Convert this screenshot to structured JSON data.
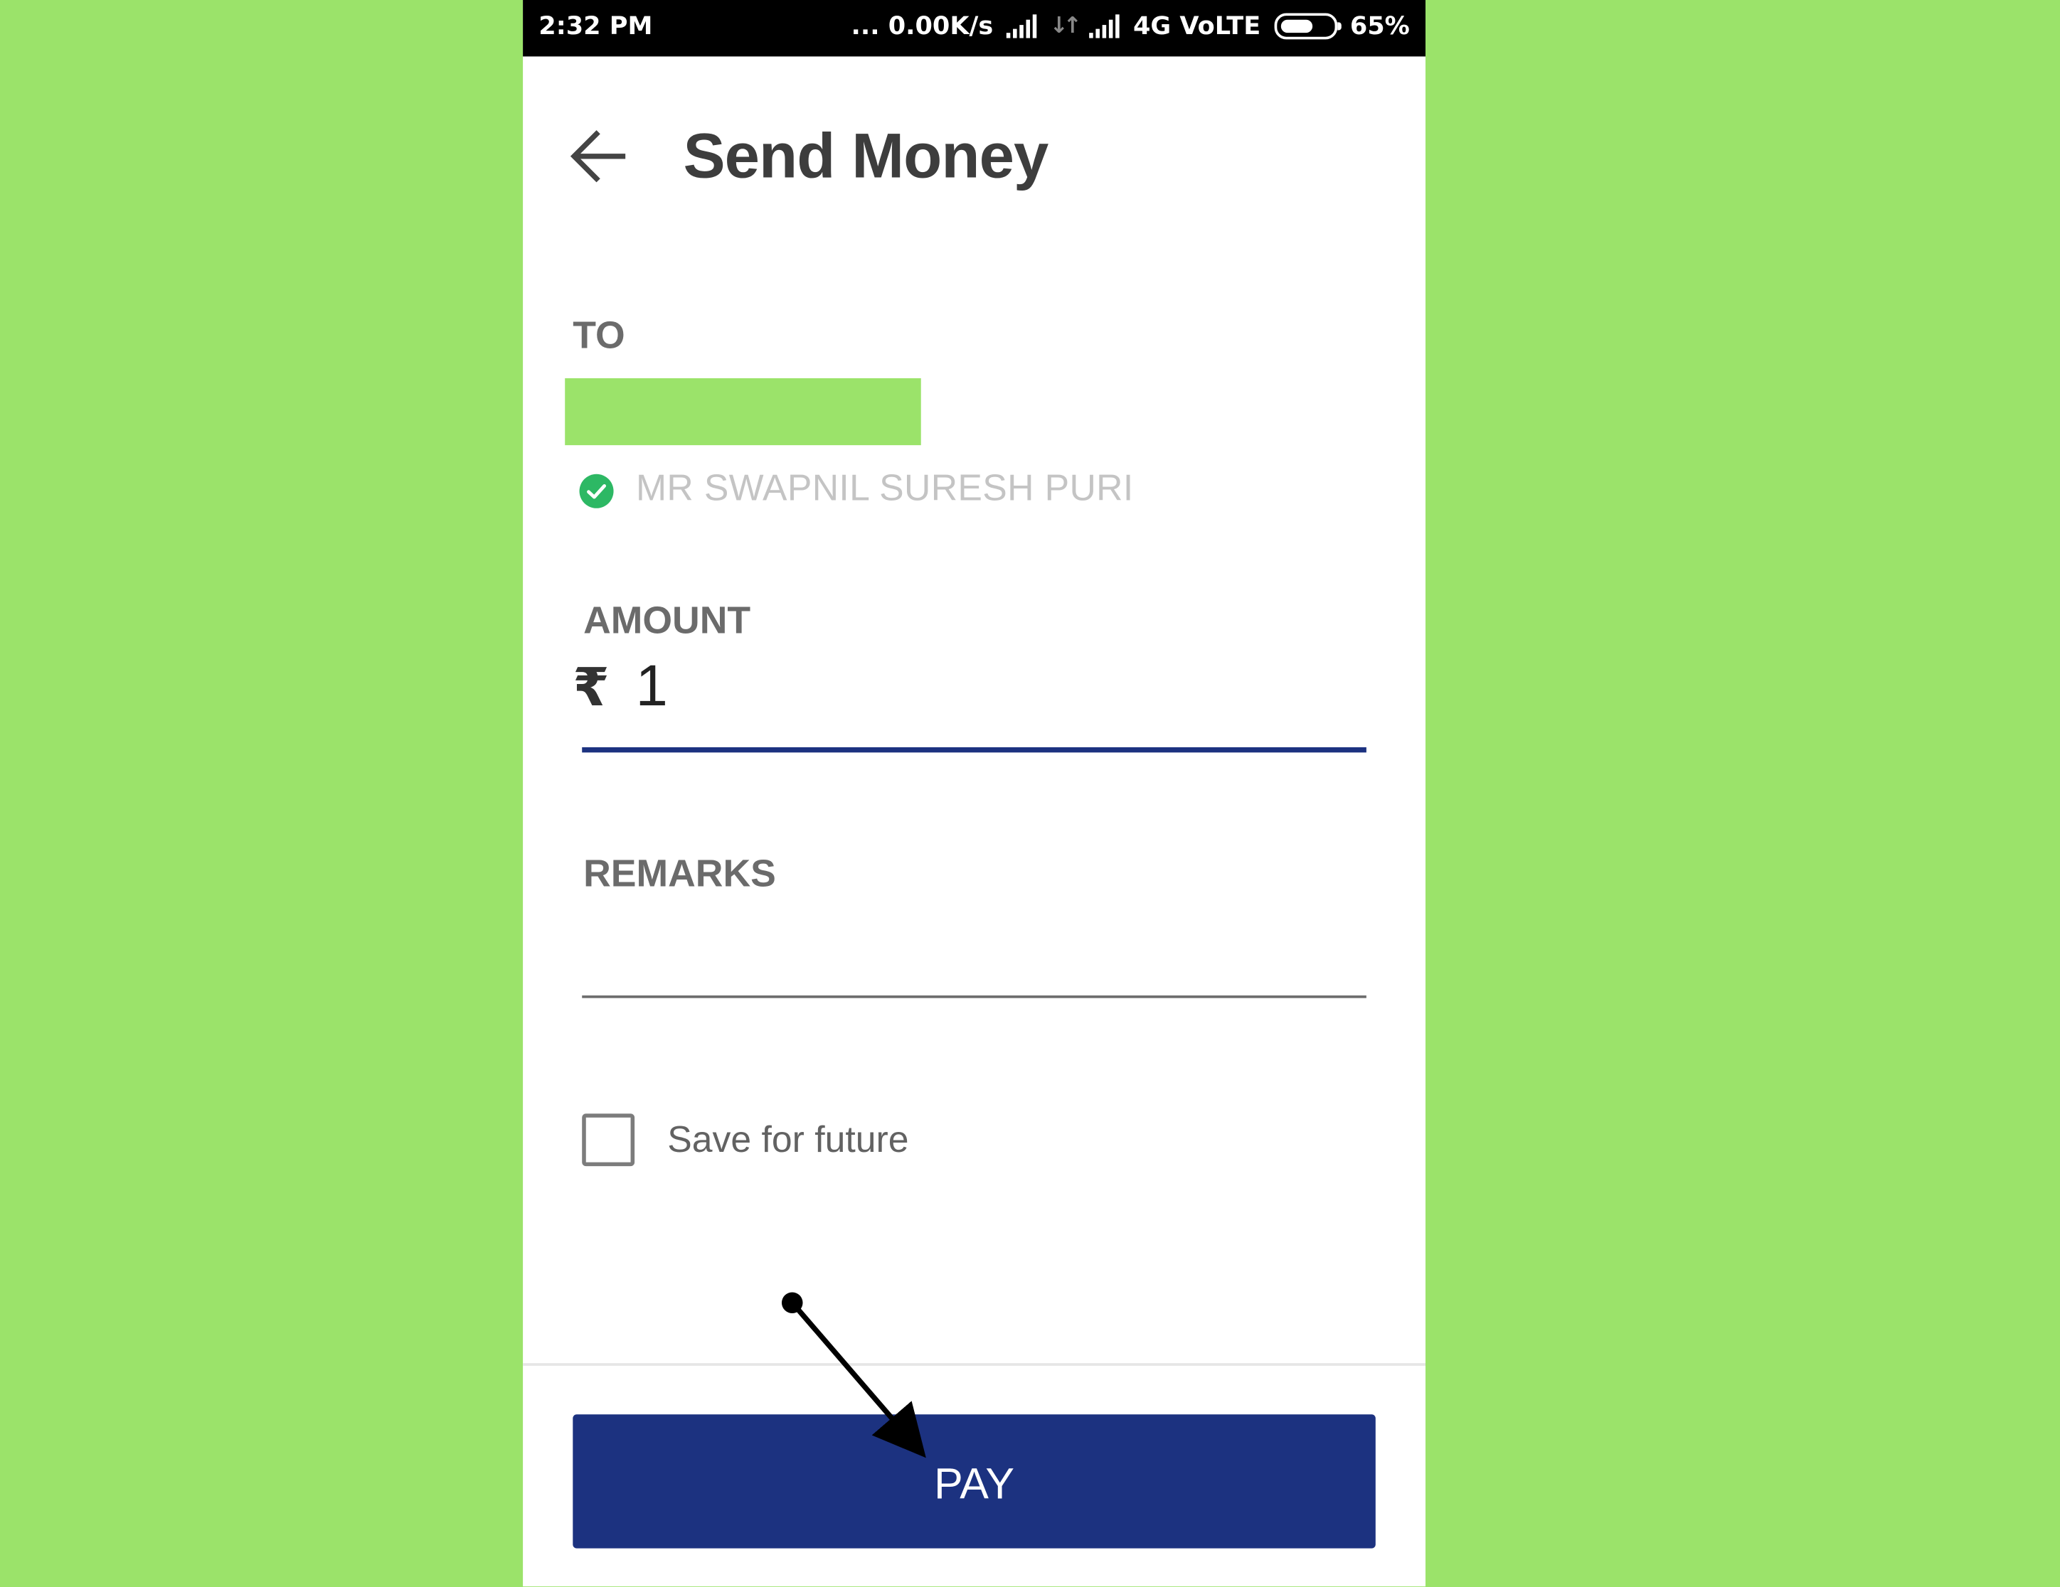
{
  "status_bar": {
    "time": "2:32 PM",
    "network_speed": "... 0.00K/s",
    "network_type": "4G VoLTE",
    "battery": "65%",
    "battery_level": 0.65
  },
  "header": {
    "title": "Send Money",
    "back_icon": "arrow-left-icon"
  },
  "form": {
    "to_label": "TO",
    "payee_name": "MR SWAPNIL SURESH PURI",
    "verified_icon": "check-circle-icon",
    "amount_label": "AMOUNT",
    "currency_symbol": "₹",
    "amount_value": "1",
    "remarks_label": "REMARKS",
    "remarks_value": "",
    "save_for_future_label": "Save for future",
    "save_for_future_checked": false
  },
  "actions": {
    "pay_label": "PAY"
  },
  "colors": {
    "background": "#9be36a",
    "primary": "#1c3280",
    "verified": "#2db864",
    "status_bar": "#000000"
  }
}
